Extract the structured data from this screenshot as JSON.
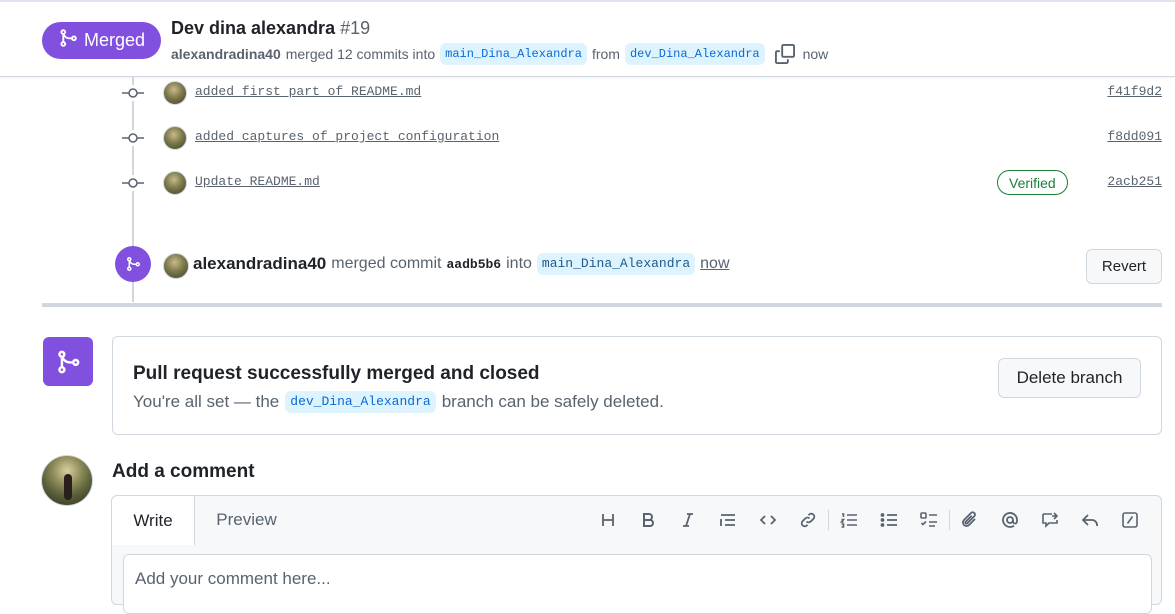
{
  "header": {
    "state_label": "Merged",
    "title": "Dev dina alexandra",
    "number": "#19",
    "author": "alexandradina40",
    "merged_text": "merged 12 commits into",
    "base_branch": "main_Dina_Alexandra",
    "from_text": "from",
    "head_branch": "dev_Dina_Alexandra",
    "time": "now"
  },
  "commits": [
    {
      "message": "added first part of README.md",
      "sha": "f41f9d2"
    },
    {
      "message": "added captures of project configuration",
      "sha": "f8dd091"
    },
    {
      "message": "Update README.md",
      "sha": "2acb251",
      "badge": "Verified"
    }
  ],
  "merge_event": {
    "author": "alexandradina40",
    "text": "merged commit",
    "sha": "aadb5b6",
    "into": "into",
    "branch": "main_Dina_Alexandra",
    "time": "now",
    "revert_label": "Revert"
  },
  "merge_box": {
    "title": "Pull request successfully merged and closed",
    "text_before": "You're all set — the",
    "branch": "dev_Dina_Alexandra",
    "text_after": "branch can be safely deleted.",
    "delete_label": "Delete branch"
  },
  "comment": {
    "heading": "Add a comment",
    "tab_write": "Write",
    "tab_preview": "Preview",
    "placeholder": "Add your comment here..."
  },
  "colors": {
    "merged_purple": "#8250df",
    "verified_green": "#1a7f37",
    "branch_bg": "#ddf4ff",
    "branch_text": "#0969da"
  }
}
